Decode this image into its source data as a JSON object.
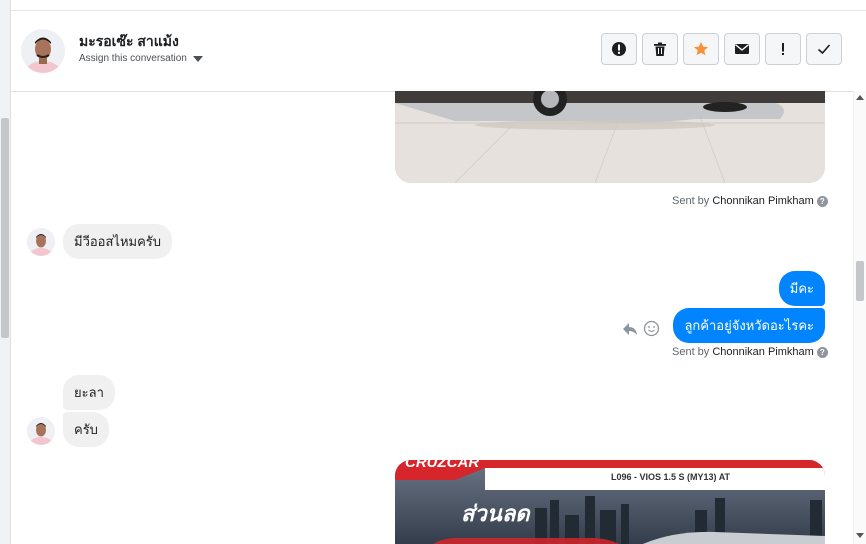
{
  "header": {
    "contact_name": "มะรอเซ๊ะ สาแม้ง",
    "assign_label": "Assign this conversation"
  },
  "actions": [
    {
      "name": "mark-spam",
      "icon": "alert-circle-icon"
    },
    {
      "name": "delete",
      "icon": "trash-icon"
    },
    {
      "name": "star",
      "icon": "star-icon"
    },
    {
      "name": "mark-unread",
      "icon": "envelope-icon"
    },
    {
      "name": "follow-up",
      "icon": "exclamation-icon"
    },
    {
      "name": "mark-done",
      "icon": "check-icon"
    }
  ],
  "colors": {
    "accent": "#0084ff",
    "star": "#f7923a",
    "incoming_bubble": "#f0f0f0"
  },
  "messages": {
    "sent_by_1": {
      "prefix": "Sent by",
      "name": "Chonnikan Pimkham"
    },
    "incoming_1": "มีวีออสไหมครับ",
    "outgoing_1": "มีคะ",
    "outgoing_2": "ลูกค้าอยู่จังหวัดอะไรคะ",
    "sent_by_2": {
      "prefix": "Sent by",
      "name": "Chonnikan Pimkham"
    },
    "incoming_2": "ยะลา",
    "incoming_3": "ครับ"
  },
  "car_ad": {
    "banner_text": "CRUZCAR",
    "model_text": "L096 - VIOS 1.5 S (MY13) AT",
    "promo_text": "ส่วนลด"
  }
}
